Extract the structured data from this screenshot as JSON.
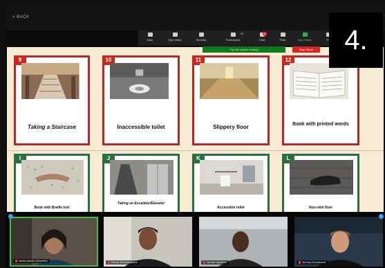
{
  "top": {
    "back_label": "< BACK",
    "step_number": "4."
  },
  "toolbar": [
    {
      "label": "Mute",
      "icon": "microphone-icon"
    },
    {
      "label": "Stop Video",
      "icon": "video-camera-icon"
    },
    {
      "label": "Security",
      "icon": "shield-icon"
    },
    {
      "label": "Participants",
      "icon": "participants-icon",
      "count": "29"
    },
    {
      "label": "Chat",
      "icon": "chat-icon",
      "badge": "1"
    },
    {
      "label": "Polls",
      "icon": "polls-icon"
    },
    {
      "label": "New Share",
      "icon": "share-screen-icon",
      "active": true
    },
    {
      "label": "Pa",
      "icon": "pause-icon"
    }
  ],
  "share": {
    "status": "You are screen sharing",
    "stop_label": "Stop Share"
  },
  "cards": [
    {
      "num": "9",
      "caption": "Taking a Staircase",
      "theme": "red"
    },
    {
      "num": "10",
      "caption": "Inaccessible toilet",
      "theme": "red"
    },
    {
      "num": "11",
      "caption": "Slippery floor",
      "theme": "red"
    },
    {
      "num": "12",
      "caption": "Book with printed words",
      "theme": "red"
    },
    {
      "num": "I",
      "caption": "Book with Braille text",
      "theme": "green"
    },
    {
      "num": "J",
      "caption": "Taking an Escalator/Elevator",
      "theme": "green"
    },
    {
      "num": "K",
      "caption": "Accessible toilet",
      "theme": "green"
    },
    {
      "num": "L",
      "caption": "Non-skid floor",
      "theme": "green"
    }
  ],
  "participants": [
    {
      "name": "Nikita Bakshi (She/Her)"
    },
    {
      "name": "Pierce Weatherspoon"
    },
    {
      "name": "Jordan Appleton"
    },
    {
      "name": "Jeremy Drummond"
    }
  ],
  "colors": {
    "red": "#b52728",
    "green": "#2d6e3e",
    "board": "#f7ebd3",
    "share": "#0f7a1e"
  }
}
